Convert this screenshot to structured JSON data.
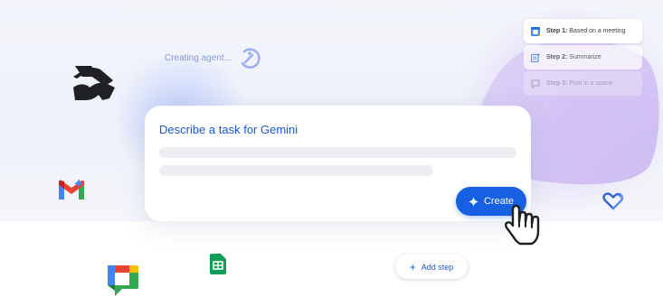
{
  "status": {
    "text": "Creating agent...",
    "icon": "magic-spinner-icon"
  },
  "steps": [
    {
      "label": "Step 1:",
      "text": "Based on a meeting",
      "icon": "calendar-icon"
    },
    {
      "label": "Step 2:",
      "text": "Summarize",
      "icon": "summarize-icon"
    },
    {
      "label": "Step 3:",
      "text": "Post in a space",
      "icon": "chat-space-icon"
    }
  ],
  "prompt_card": {
    "title": "Describe a task for Gemini",
    "create_label": "Create",
    "create_icon": "sparkle-icon"
  },
  "add_step": {
    "label": "Add step",
    "icon": "plus-icon"
  },
  "logos": [
    "workspace-logo",
    "gmail-logo",
    "sheets-logo",
    "chat-logo",
    "gemini-heart-logo"
  ],
  "colors": {
    "accent": "#1760e3",
    "title_text": "#1a56d6"
  }
}
